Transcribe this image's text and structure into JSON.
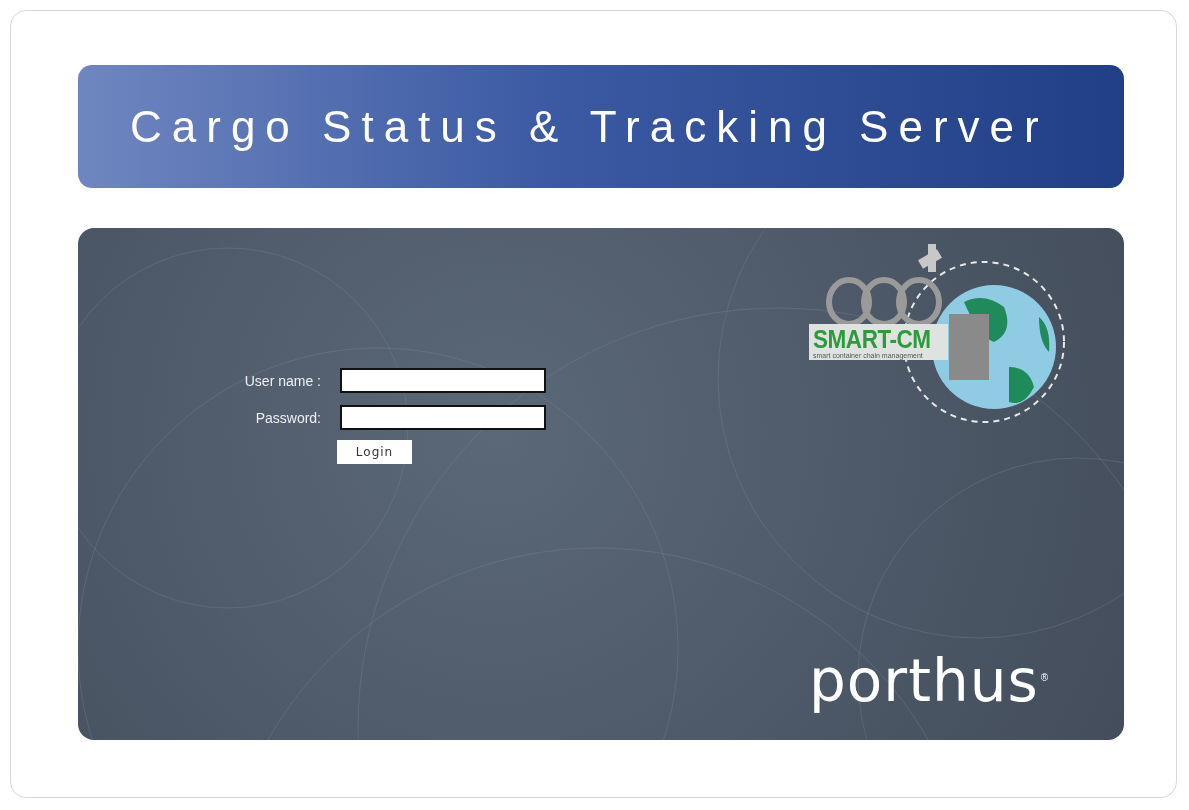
{
  "header": {
    "title": "Cargo Status & Tracking Server"
  },
  "login_form": {
    "fields": [
      {
        "label": "User name :"
      },
      {
        "label": "Password:"
      }
    ],
    "button": "Login"
  },
  "product_logo": {
    "name": "SMART-CM",
    "tagline": "smart container chain management"
  },
  "company_logo": {
    "name": "porthus",
    "mark": "®"
  }
}
